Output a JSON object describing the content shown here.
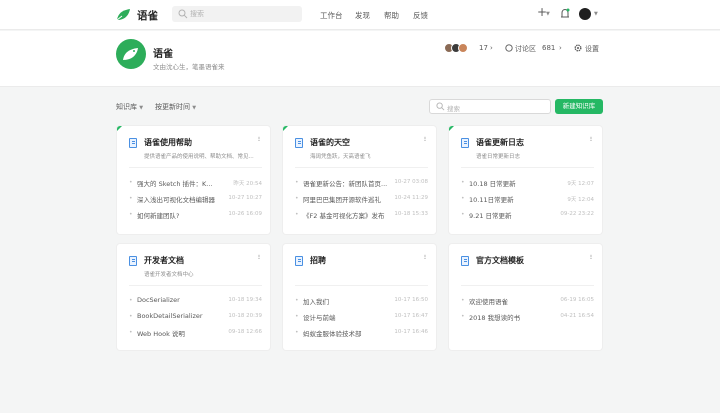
{
  "nav": {
    "brand": "语雀",
    "search_placeholder": "搜索",
    "links": [
      "工作台",
      "发现",
      "帮助",
      "反馈"
    ]
  },
  "repo": {
    "title": "语雀",
    "description": "文由沈心生，笔墨语雀来",
    "members_count": "17",
    "discussion_label": "讨论区",
    "discussion_count": "681",
    "settings_label": "设置"
  },
  "toolbar": {
    "filter_label": "知识库",
    "sort_label": "按更新时间",
    "search_placeholder": "搜索",
    "new_button": "新建知识库"
  },
  "colors": {
    "accent": "#25b864",
    "brand_logo": "#2dad5a",
    "doc_icon": "#4a90e2"
  },
  "cards": [
    {
      "title": "语雀使用帮助",
      "desc": "提供语雀产品的使用说明、帮助文档、常见...",
      "items": [
        {
          "text": "强大的 Sketch 插件：K...",
          "date": "昨天 20:54"
        },
        {
          "text": "深入浅出可视化文档编辑器",
          "date": "10-27 10:27"
        },
        {
          "text": "如何新建团队?",
          "date": "10-26 16:09"
        }
      ]
    },
    {
      "title": "语雀的天空",
      "desc": "海阔凭鱼跃，天高语雀飞",
      "items": [
        {
          "text": "语雀更新公告：新团队首页...",
          "date": "10-27 03:08"
        },
        {
          "text": "阿里巴巴集团开源软件巡礼",
          "date": "10-24 11:29"
        },
        {
          "text": "《F2 基金可视化方案》发布",
          "date": "10-18 15:33"
        }
      ]
    },
    {
      "title": "语雀更新日志",
      "desc": "语雀日常更新日志",
      "items": [
        {
          "text": "10.18 日常更新",
          "date": "9天 12:07"
        },
        {
          "text": "10.11日常更新",
          "date": "9天 12:04"
        },
        {
          "text": "9.21 日常更新",
          "date": "09-22 23:22"
        }
      ]
    },
    {
      "title": "开发者文档",
      "desc": "语雀开发者文档中心",
      "items": [
        {
          "text": "DocSerializer",
          "date": "10-18 19:34"
        },
        {
          "text": "BookDetailSerializer",
          "date": "10-18 20:39"
        },
        {
          "text": "Web Hook 说明",
          "date": "09-18 12:66"
        }
      ]
    },
    {
      "title": "招聘",
      "desc": "",
      "items": [
        {
          "text": "加入我们",
          "date": "10-17 16:50"
        },
        {
          "text": "设计与前端",
          "date": "10-17 16:47"
        },
        {
          "text": "蚂蚁金服体验技术部",
          "date": "10-17 16:46"
        }
      ]
    },
    {
      "title": "官方文档模板",
      "desc": "",
      "items": [
        {
          "text": "欢迎使用语雀",
          "date": "06-19 16:05"
        },
        {
          "text": "2018 我想读的书",
          "date": "04-21 16:54"
        }
      ]
    }
  ]
}
